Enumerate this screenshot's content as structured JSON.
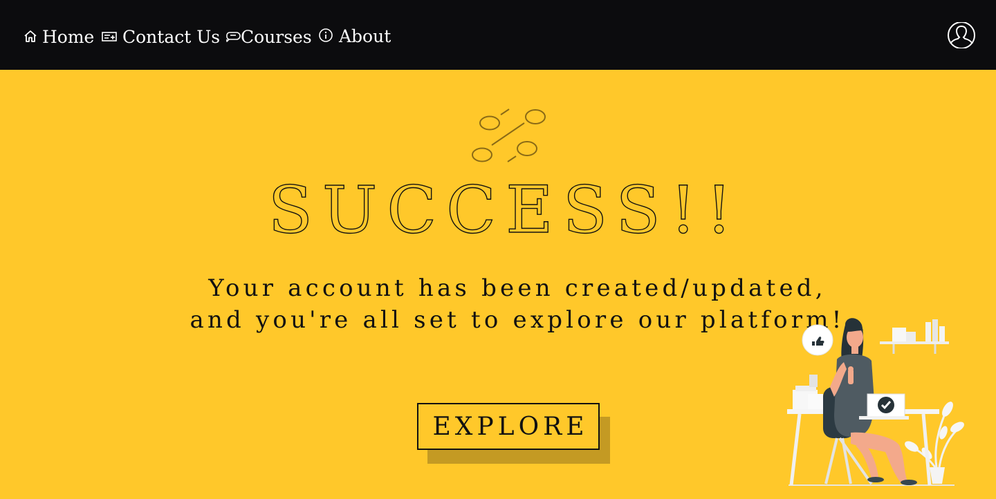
{
  "nav": {
    "items": [
      {
        "label": "Home",
        "icon": "home-icon"
      },
      {
        "label": "Contact Us",
        "icon": "contact-card-icon"
      },
      {
        "label": "Courses",
        "icon": "chat-bubble-icon"
      },
      {
        "label": "About",
        "icon": "info-icon"
      }
    ],
    "profile_icon": "user-icon"
  },
  "hero": {
    "icon": "success-sparkle-icon",
    "title": "SUCCESS!!",
    "message_line1": "Your account has been created/updated,",
    "message_line2": "and you're all set to explore our platform!",
    "button_label": "EXPLORE"
  },
  "colors": {
    "background": "#ffc82a",
    "navbar": "#0c0c0e",
    "text": "#111111",
    "button_shadow": "#c49a23"
  }
}
